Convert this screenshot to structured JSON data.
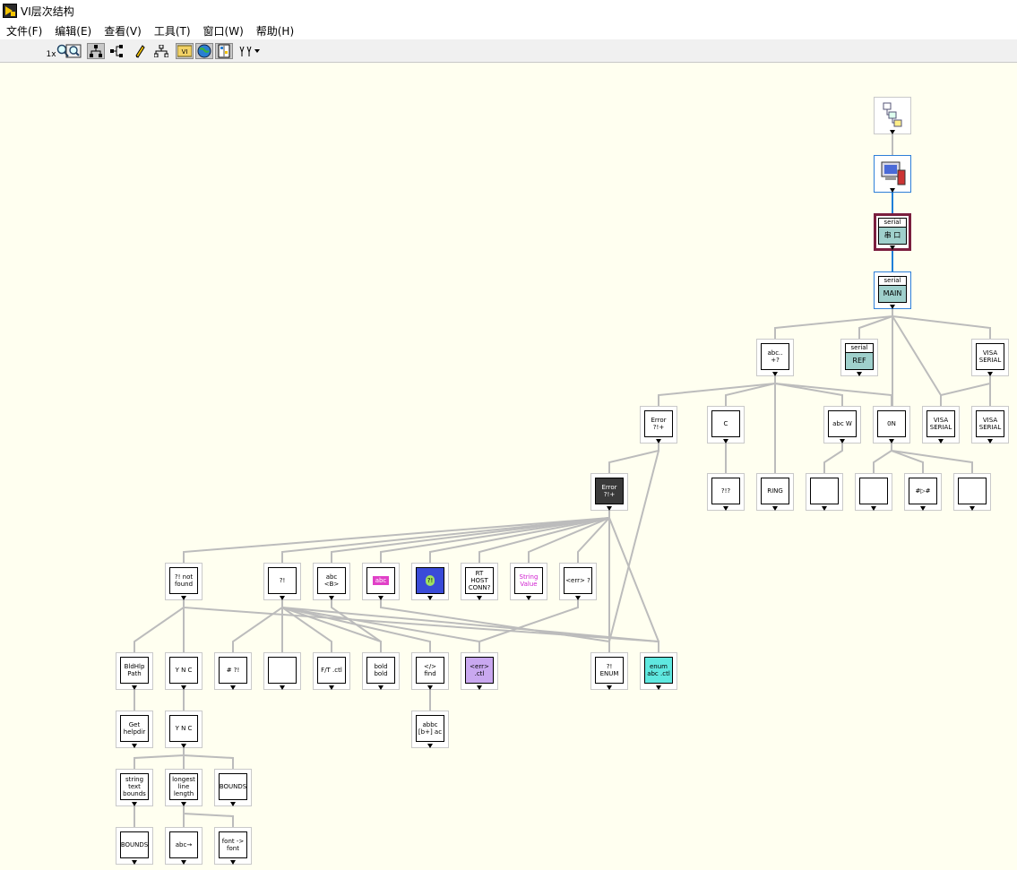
{
  "window": {
    "title": "VI层次结构"
  },
  "menu": [
    {
      "id": "file",
      "label": "文件(F)"
    },
    {
      "id": "edit",
      "label": "编辑(E)"
    },
    {
      "id": "view",
      "label": "查看(V)"
    },
    {
      "id": "tools",
      "label": "工具(T)"
    },
    {
      "id": "window",
      "label": "窗口(W)"
    },
    {
      "id": "help",
      "label": "帮助(H)"
    }
  ],
  "toolbar": {
    "zoom_label": "1x",
    "buttons": [
      "zoom-icon",
      "zoom-fit-icon",
      "vertical-layout-icon",
      "horizontal-layout-icon",
      "edit-pencil-icon",
      "redo-layout-icon",
      "vi-lib-icon",
      "globals-icon",
      "typedefs-icon",
      "show-all-icon"
    ]
  },
  "colors": {
    "canvas": "#fffff0",
    "line": "#bcbcbc",
    "selected_line": "#1e7fd8",
    "selected_border": "#7b1f3f"
  },
  "nodes": [
    {
      "id": "root",
      "icon": "project-hierarchy-icon",
      "text": ""
    },
    {
      "id": "computer",
      "icon": "computer-icon",
      "text": ""
    },
    {
      "id": "serial-port",
      "icon": "serial-port-vi-icon",
      "header": "serial",
      "text": "串 口"
    },
    {
      "id": "serial-main",
      "icon": "serial-main-vi-icon",
      "header": "serial",
      "text": "MAIN"
    },
    {
      "id": "abc-save",
      "icon": "abc-save-icon",
      "text": "abc.. +?"
    },
    {
      "id": "serial-ref",
      "icon": "serial-ref-icon",
      "header": "serial",
      "text": "REF"
    },
    {
      "id": "visa-serial-1",
      "icon": "visa-serial-icon",
      "text": "VISA SERIAL"
    },
    {
      "id": "error-handler-1",
      "icon": "error-handler-icon",
      "text": "Error ?!+"
    },
    {
      "id": "save-c",
      "icon": "save-c-icon",
      "text": "C"
    },
    {
      "id": "abc-w",
      "icon": "abc-write-icon",
      "text": "abc W"
    },
    {
      "id": "save-on",
      "icon": "save-on-icon",
      "text": "0N"
    },
    {
      "id": "visa-serial-2",
      "icon": "visa-serial-icon",
      "text": "VISA SERIAL"
    },
    {
      "id": "visa-serial-3",
      "icon": "visa-serial-icon",
      "text": "VISA SERIAL"
    },
    {
      "id": "error-handler-2",
      "icon": "error-handler-dark-icon",
      "text": "Error ?!+"
    },
    {
      "id": "help-search",
      "icon": "help-search-icon",
      "text": "?!?"
    },
    {
      "id": "ring",
      "icon": "ring-icon",
      "text": "RING"
    },
    {
      "id": "file-doc",
      "icon": "file-doc-icon",
      "text": ""
    },
    {
      "id": "folder",
      "icon": "folder-icon",
      "text": ""
    },
    {
      "id": "arrow-hash",
      "icon": "arrow-hash-icon",
      "text": "#▷#"
    },
    {
      "id": "eye-doc",
      "icon": "eye-doc-icon",
      "text": ""
    },
    {
      "id": "not-found",
      "icon": "not-found-icon",
      "text": "?! not found"
    },
    {
      "id": "dialog-msg",
      "icon": "dialog-icon",
      "text": "?!"
    },
    {
      "id": "abc-bold",
      "icon": "abc-bold-icon",
      "text": "abc <B>"
    },
    {
      "id": "abc-pink",
      "icon": "abc-pink-icon",
      "text": "abc"
    },
    {
      "id": "db-convert",
      "icon": "database-icon",
      "text": "?!"
    },
    {
      "id": "rt-host",
      "icon": "rt-host-icon",
      "text": "RT HOST CONN?"
    },
    {
      "id": "string-value",
      "icon": "string-value-icon",
      "text": "String Value"
    },
    {
      "id": "err-q",
      "icon": "err-tag-icon",
      "text": "<err> ?"
    },
    {
      "id": "bldhlp-path",
      "icon": "bldhlp-path-icon",
      "text": "BldHlp Path"
    },
    {
      "id": "ync-1",
      "icon": "ync-dialog-icon",
      "text": "Y N C"
    },
    {
      "id": "pencil-eraser",
      "icon": "pencil-eraser-icon",
      "text": "# ?!"
    },
    {
      "id": "pc-panel",
      "icon": "panel-icon",
      "text": ""
    },
    {
      "id": "warning-ctl",
      "icon": "warning-ctl-icon",
      "text": "F/T .ctl"
    },
    {
      "id": "bold-bold",
      "icon": "bold-bold-icon",
      "text": "bold bold"
    },
    {
      "id": "find-tag",
      "icon": "find-tag-icon",
      "text": "</> find"
    },
    {
      "id": "err-ctl",
      "icon": "err-ctl-icon",
      "text": "<err> .ctl"
    },
    {
      "id": "enum-help",
      "icon": "enum-help-icon",
      "text": "?! ENUM"
    },
    {
      "id": "enum-ctl",
      "icon": "enum-ctl-icon",
      "text": "enum abc .ctl"
    },
    {
      "id": "get-helpdir",
      "icon": "get-helpdir-icon",
      "text": "Get helpdir"
    },
    {
      "id": "ync-2",
      "icon": "ync-dialog-icon",
      "text": "Y N C"
    },
    {
      "id": "abbc",
      "icon": "abbc-icon",
      "text": "abbc [b+] ac"
    },
    {
      "id": "string-bounds",
      "icon": "string-bounds-icon",
      "text": "string text bounds"
    },
    {
      "id": "longest-line",
      "icon": "longest-line-icon",
      "text": "longest line length"
    },
    {
      "id": "bounds-1",
      "icon": "bounds-icon",
      "text": "BOUNDS"
    },
    {
      "id": "bounds-2",
      "icon": "bounds-icon",
      "text": "BOUNDS"
    },
    {
      "id": "abc-arrow",
      "icon": "abc-arrow-icon",
      "text": "abc→"
    },
    {
      "id": "font-font",
      "icon": "font-icon",
      "text": "font -> font"
    }
  ]
}
